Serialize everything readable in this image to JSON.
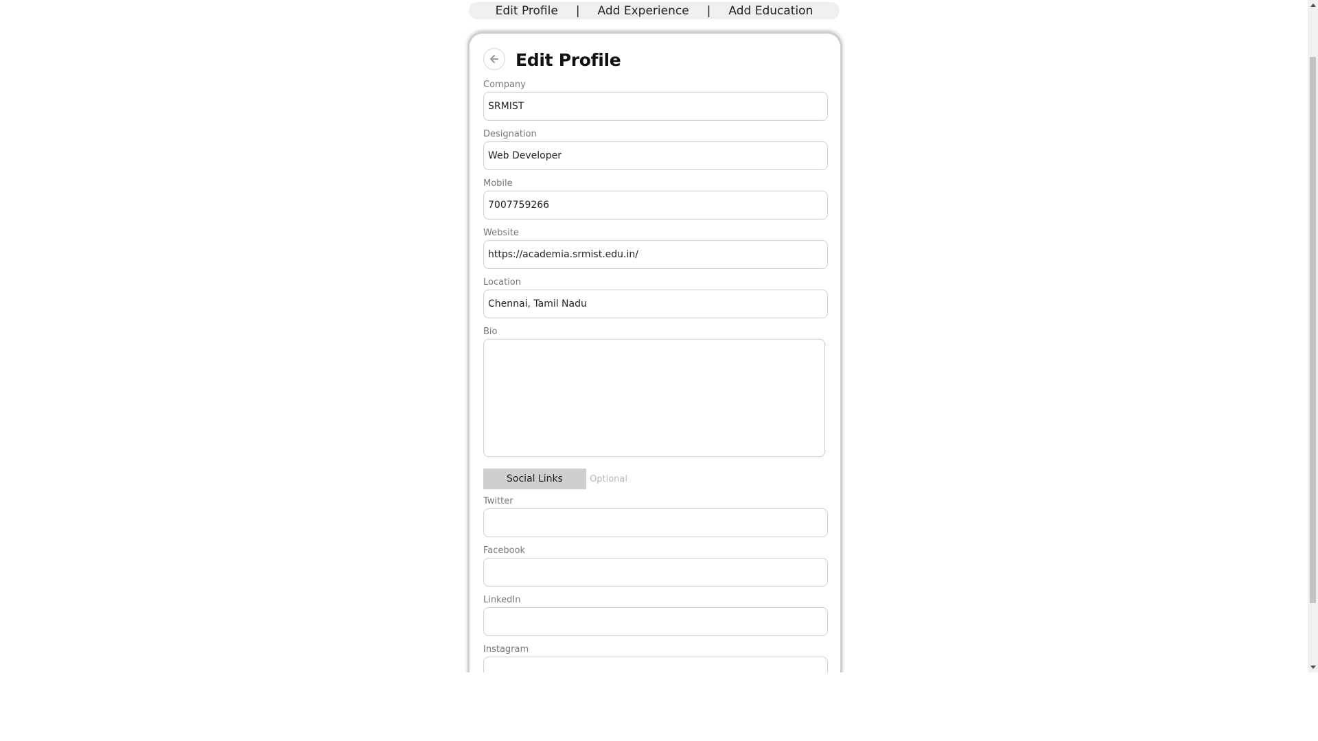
{
  "nav": {
    "items": [
      "Edit Profile",
      "Add Experience",
      "Add Education"
    ],
    "separator": "|"
  },
  "card": {
    "title": "Edit Profile",
    "back_icon": "arrow-left-icon"
  },
  "fields": {
    "company": {
      "label": "Company",
      "value": "SRMIST"
    },
    "designation": {
      "label": "Designation",
      "value": "Web Developer"
    },
    "mobile": {
      "label": "Mobile",
      "value": "7007759266"
    },
    "website": {
      "label": "Website",
      "value": "https://academia.srmist.edu.in/"
    },
    "location": {
      "label": "Location",
      "value": "Chennai, Tamil Nadu"
    },
    "bio": {
      "label": "Bio",
      "value": ""
    }
  },
  "social": {
    "button_label": "Social Links",
    "optional_label": "Optional",
    "twitter": {
      "label": "Twitter",
      "value": ""
    },
    "facebook": {
      "label": "Facebook",
      "value": ""
    },
    "linkedin": {
      "label": "LinkedIn",
      "value": ""
    },
    "instagram": {
      "label": "Instagram",
      "value": ""
    }
  },
  "colors": {
    "nav_bg": "#efefef",
    "social_btn_bg": "#cfcfcf",
    "input_border": "#cfcfcf"
  }
}
